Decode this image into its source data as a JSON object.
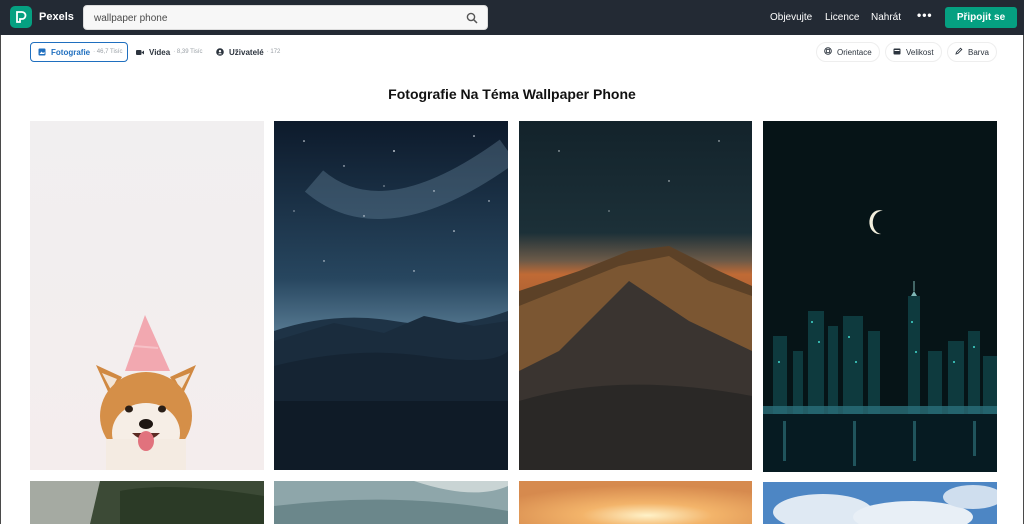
{
  "header": {
    "brand": "Pexels",
    "search_value": "wallpaper phone",
    "nav": [
      "Objevujte",
      "Licence",
      "Nahrát"
    ],
    "more": "•••",
    "join_label": "Připojit se"
  },
  "filters": {
    "tabs": [
      {
        "label": "Fotografie",
        "count": "· 46,7 Tisíc",
        "icon": "image-icon"
      },
      {
        "label": "Videa",
        "count": "· 8,39 Tisíc",
        "icon": "video-icon"
      },
      {
        "label": "Uživatelé",
        "count": "· 172",
        "icon": "user-icon"
      }
    ],
    "options": [
      {
        "label": "Orientace",
        "icon": "orientation-icon"
      },
      {
        "label": "Velikost",
        "icon": "size-icon"
      },
      {
        "label": "Barva",
        "icon": "pen-icon"
      }
    ]
  },
  "page_title": "Fotografie Na Téma Wallpaper Phone",
  "photos": [
    {
      "subject": "shiba-dog-party-hat"
    },
    {
      "subject": "starry-sky-mountains"
    },
    {
      "subject": "mountain-peak-night"
    },
    {
      "subject": "city-skyline-moon"
    },
    {
      "subject": "forest"
    },
    {
      "subject": "mist"
    },
    {
      "subject": "sunset"
    },
    {
      "subject": "clouds"
    }
  ],
  "colors": {
    "brand": "#05a081",
    "topbar": "#232a34",
    "active_tab": "#1f6fbf"
  }
}
